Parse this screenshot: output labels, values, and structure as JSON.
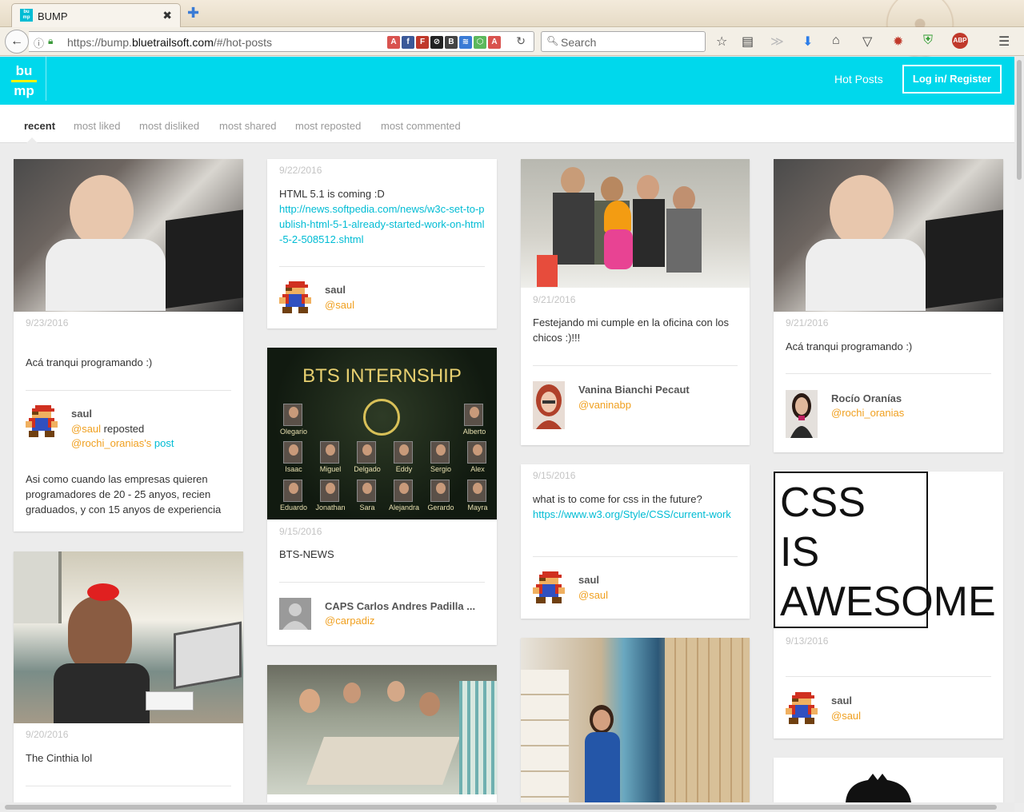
{
  "browser": {
    "tab_title": "BUMP",
    "tab_favicon": "bump-favicon",
    "close_glyph": "✖",
    "new_tab_glyph": "✚",
    "url_prefix": "https://bump.",
    "url_domain": "bluetrailsoft.com",
    "url_path": "/#/hot-posts",
    "search_placeholder": "Search",
    "icons": [
      "back-icon",
      "info-icon",
      "lock-icon",
      "reload-icon",
      "search-icon",
      "bookmark-star-icon",
      "reading-list-icon",
      "pocket-icon",
      "download-icon",
      "home-icon",
      "pocket-save-icon",
      "extension-icon",
      "shield-icon",
      "adblock-icon",
      "menu-icon"
    ]
  },
  "header": {
    "logo_top": "bu",
    "logo_bottom": "mp",
    "hot_posts": "Hot Posts",
    "login": "Log in/ Register",
    "brand_color": "#00d8ec"
  },
  "sort_tabs": [
    "recent",
    "most liked",
    "most disliked",
    "most shared",
    "most reposted",
    "most commented"
  ],
  "posts": {
    "p1": {
      "date": "9/23/2016",
      "text": "Acá tranqui programando :)",
      "user": "saul",
      "handle": "@saul",
      "reposted": "reposted",
      "orig_handle": "@rochi_oranias's",
      "post_link": "post",
      "body": "Asi como cuando las empresas quieren programadores de 20 - 25 anyos, recien graduados, y con 15 anyos de experiencia"
    },
    "p2": {
      "date": "9/20/2016",
      "text": "The Cinthia lol"
    },
    "p3": {
      "date": "9/22/2016",
      "text": "HTML 5.1 is coming :D",
      "link": "http://news.softpedia.com/news/w3c-set-to-publish-html-5-1-already-started-work-on-html-5-2-508512.shtml",
      "user": "saul",
      "handle": "@saul"
    },
    "p4": {
      "banner_title": "BTS INTERNSHIP",
      "names": [
        "Olegario",
        "Alberto",
        "Isaac",
        "Miguel",
        "Delgado",
        "Eddy",
        "Sergio",
        "Alex",
        "Eduardo",
        "Jonathan",
        "Sara",
        "Alejandra",
        "Gerardo",
        "Mayra"
      ],
      "date": "9/15/2016",
      "text": "BTS-NEWS",
      "user": "CAPS Carlos Andres Padilla ...",
      "handle": "@carpadiz"
    },
    "p5": {
      "date": "9/21/2016",
      "text": "Festejando mi cumple en la oficina con los chicos :)!!!",
      "user": "Vanina Bianchi Pecaut",
      "handle": "@vaninabp"
    },
    "p6": {
      "date": "9/15/2016",
      "text": "what is to come for css in the future?",
      "link": "https://www.w3.org/Style/CSS/current-work",
      "user": "saul",
      "handle": "@saul"
    },
    "p7": {
      "date": "9/21/2016",
      "text": "Acá tranqui programando :)",
      "user": "Rocío Oranías",
      "handle": "@rochi_oranias"
    },
    "p8": {
      "line1": "CSS",
      "line2": "IS",
      "line3": "AWESOME",
      "date": "9/13/2016",
      "user": "saul",
      "handle": "@saul"
    }
  }
}
